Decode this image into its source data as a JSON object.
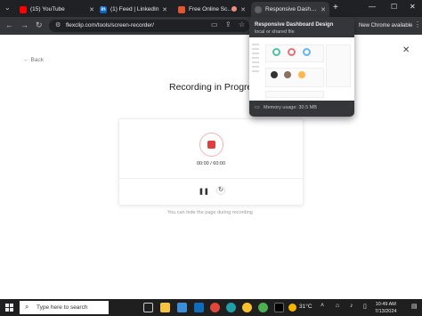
{
  "browser": {
    "tabs": [
      {
        "label": "(15) YouTube",
        "icon": "youtube-icon",
        "color": "#ff0000"
      },
      {
        "label": "(1) Feed | LinkedIn",
        "icon": "linkedin-icon",
        "color": "#0a66c2"
      },
      {
        "label": "Free Online Scree",
        "icon": "flexclip-icon",
        "color": "#e4572e"
      },
      {
        "label": "Responsive Dashboa",
        "icon": "file-icon",
        "color": "#5f6368"
      }
    ],
    "new_tab": "+",
    "url": "flexclip.com/tools/screen-recorder/",
    "new_chrome_label": "New Chrome available",
    "tab_preview": {
      "title": "Responsive Dashboard Design",
      "subtitle": "local or shared file",
      "memory": "Memory usage: 30.5 MB"
    }
  },
  "page": {
    "back_label": "Back",
    "title": "Recording in Progress",
    "timer": "00:00 / 60:00",
    "hint": "You can hide the page during recording",
    "accent": "#e43c3c"
  },
  "taskbar": {
    "search_placeholder": "Type here to search",
    "weather": "31°C",
    "time": "10:49 AM",
    "date": "7/13/2024"
  }
}
